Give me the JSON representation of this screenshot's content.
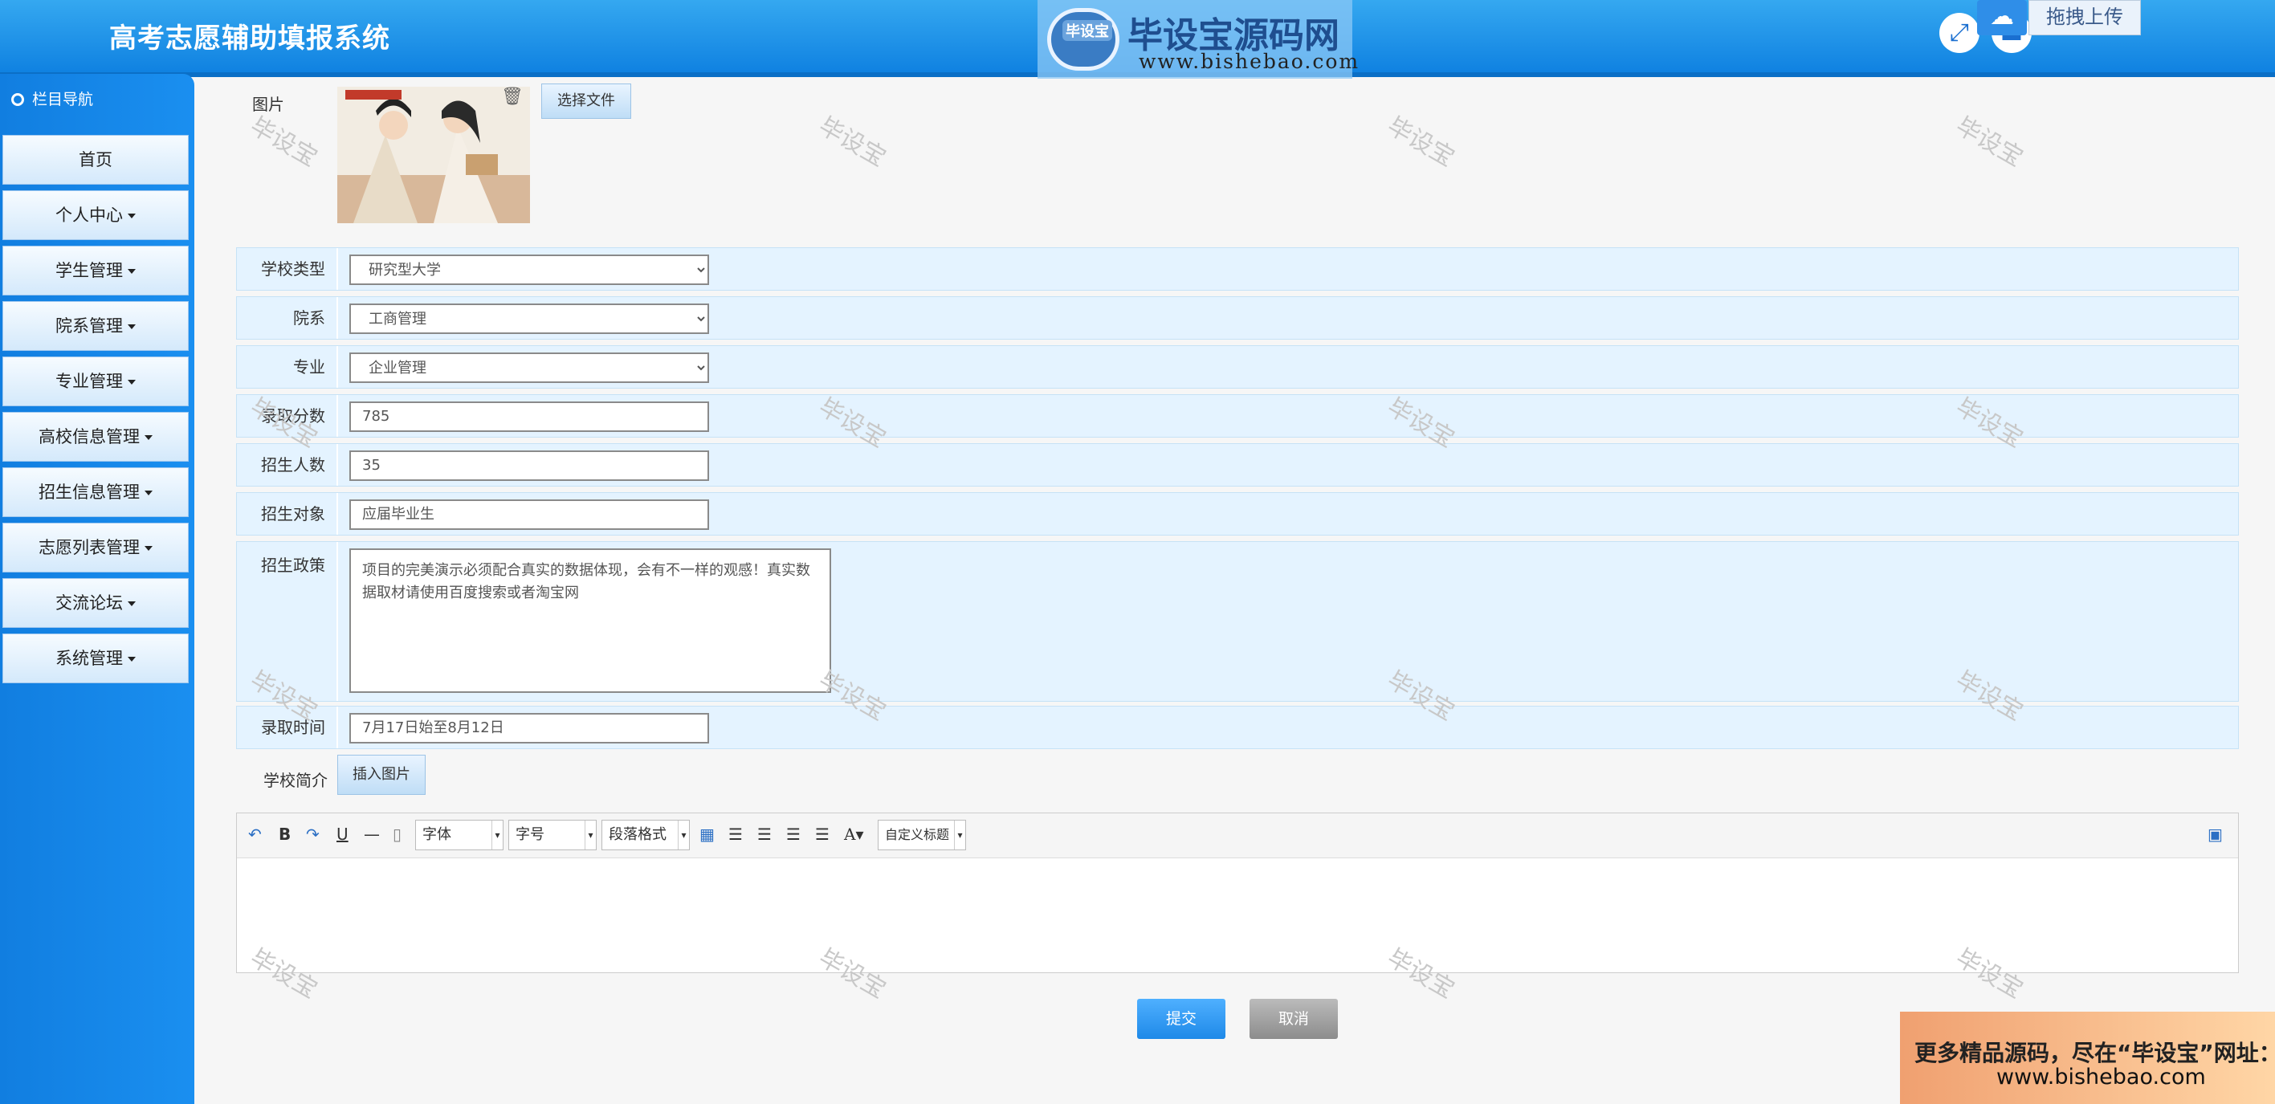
{
  "header": {
    "app_title": "高考志愿辅助填报系统",
    "logo_badge": "毕设宝",
    "logo_title": "毕设宝源码网",
    "logo_url": "www.bishebao.com",
    "fullscreen_icon": "expand-icon",
    "user_icon": "user-icon",
    "upload_label": "拖拽上传",
    "upload_icon": "cloud-upload-icon"
  },
  "sidebar": {
    "heading": "栏目导航",
    "items": [
      {
        "label": "首页",
        "dropdown": false
      },
      {
        "label": "个人中心",
        "dropdown": true
      },
      {
        "label": "学生管理",
        "dropdown": true
      },
      {
        "label": "院系管理",
        "dropdown": true
      },
      {
        "label": "专业管理",
        "dropdown": true
      },
      {
        "label": "高校信息管理",
        "dropdown": true
      },
      {
        "label": "招生信息管理",
        "dropdown": true
      },
      {
        "label": "志愿列表管理",
        "dropdown": true
      },
      {
        "label": "交流论坛",
        "dropdown": true
      },
      {
        "label": "系统管理",
        "dropdown": true
      }
    ]
  },
  "form": {
    "image_label": "图片",
    "choose_file": "选择文件",
    "school_type_label": "学校类型",
    "school_type_value": "研究型大学",
    "department_label": "院系",
    "department_value": "工商管理",
    "major_label": "专业",
    "major_value": "企业管理",
    "score_label": "录取分数",
    "score_value": "785",
    "enroll_count_label": "招生人数",
    "enroll_count_value": "35",
    "target_label": "招生对象",
    "target_value": "应届毕业生",
    "policy_label": "招生政策",
    "policy_value": "项目的完美演示必须配合真实的数据体现，会有不一样的观感！真实数据取材请使用百度搜索或者淘宝网",
    "admission_time_label": "录取时间",
    "admission_time_value": "7月17日始至8月12日",
    "intro_label": "学校简介",
    "insert_image": "插入图片"
  },
  "editor": {
    "font_placeholder": "字体",
    "size_placeholder": "字号",
    "paragraph_placeholder": "段落格式",
    "custom_title": "自定义标题"
  },
  "actions": {
    "submit": "提交",
    "cancel": "取消"
  },
  "watermark_text": "毕设宝",
  "ad": {
    "line1": "更多精品源码，尽在“毕设宝”网址：",
    "line2": "www.bishebao.com"
  }
}
